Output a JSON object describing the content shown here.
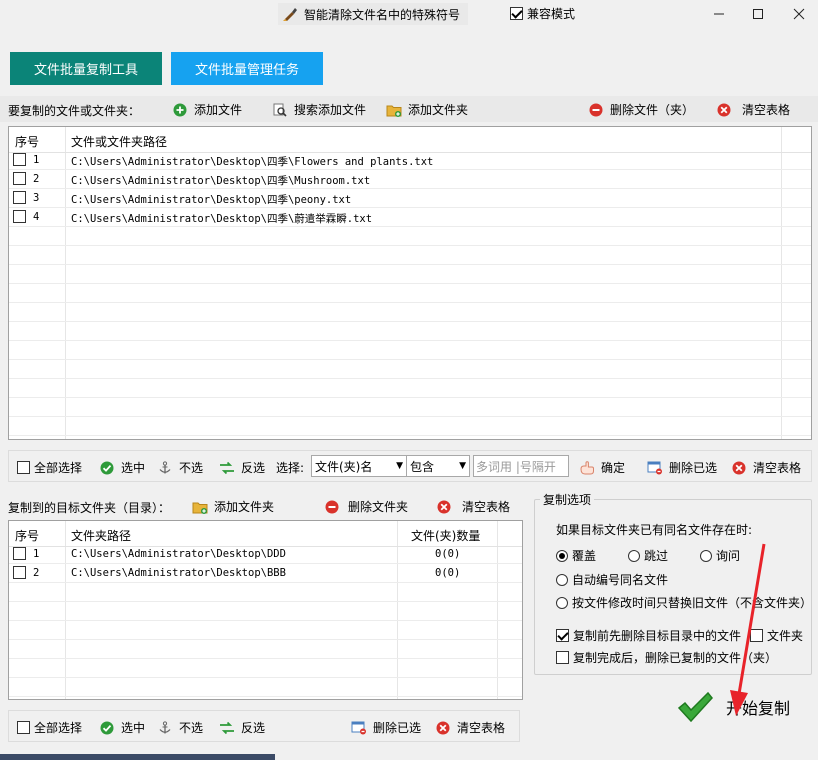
{
  "window": {
    "title": "智能清除文件名中的特殊符号",
    "compat_label": "兼容模式",
    "compat_checked": true,
    "min_icon": "minimize-icon",
    "max_icon": "maximize-icon",
    "close_icon": "close-icon"
  },
  "tabs": [
    {
      "label": "文件批量复制工具"
    },
    {
      "label": "文件批量管理任务"
    }
  ],
  "source": {
    "section_label": "要复制的文件或文件夹：",
    "add_file": "添加文件",
    "search_add": "搜索添加文件",
    "add_folder": "添加文件夹",
    "delete": "删除文件（夹）",
    "clear": "清空表格",
    "col_index": "序号",
    "col_path": "文件或文件夹路径",
    "rows": [
      {
        "index": "1",
        "path": "C:\\Users\\Administrator\\Desktop\\四季\\Flowers and plants.txt"
      },
      {
        "index": "2",
        "path": "C:\\Users\\Administrator\\Desktop\\四季\\Mushroom.txt"
      },
      {
        "index": "3",
        "path": "C:\\Users\\Administrator\\Desktop\\四季\\peony.txt"
      },
      {
        "index": "4",
        "path": "C:\\Users\\Administrator\\Desktop\\四季\\蔚遣举霖瞬.txt"
      }
    ]
  },
  "source_bar": {
    "select_all": "全部选择",
    "select": "选中",
    "deselect": "不选",
    "invert": "反选",
    "filter_label": "选择:",
    "filter_field": "文件(夹)名",
    "filter_op": "包含",
    "filter_placeholder": "多词用 |号隔开",
    "confirm": "确定",
    "delete_selected": "删除已选",
    "clear": "清空表格"
  },
  "target": {
    "section_label": "复制到的目标文件夹（目录）：",
    "add_folder": "添加文件夹",
    "delete_folder": "删除文件夹",
    "clear": "清空表格",
    "col_index": "序号",
    "col_path": "文件夹路径",
    "col_count": "文件(夹)数量",
    "rows": [
      {
        "index": "1",
        "path": "C:\\Users\\Administrator\\Desktop\\DDD",
        "count": "0(0)"
      },
      {
        "index": "2",
        "path": "C:\\Users\\Administrator\\Desktop\\BBB",
        "count": "0(0)"
      }
    ]
  },
  "target_bar": {
    "select_all": "全部选择",
    "select": "选中",
    "deselect": "不选",
    "invert": "反选",
    "delete_selected": "删除已选",
    "clear": "清空表格"
  },
  "options": {
    "group_title": "复制选项",
    "same_name_label": "如果目标文件夹已有同名文件存在时:",
    "overwrite": "覆盖",
    "skip": "跳过",
    "ask": "询问",
    "auto_number": "自动编号同名文件",
    "replace_old": "按文件修改时间只替换旧文件（不含文件夹）",
    "delete_before": "复制前先删除目标目录中的文件",
    "folder": "文件夹",
    "delete_after": "复制完成后，删除已复制的文件（夹）",
    "selected_mode": "覆盖"
  },
  "start": {
    "label": "开始复制",
    "icon": "green-checkmark-icon",
    "annotation_color": "#e8232a"
  },
  "colors": {
    "tab1_bg": "#0b8478",
    "tab2_bg": "#16a2f0",
    "add_green": "#2e9a3a",
    "delete_red": "#d9322b",
    "folder_yellow": "#e7b43a"
  }
}
